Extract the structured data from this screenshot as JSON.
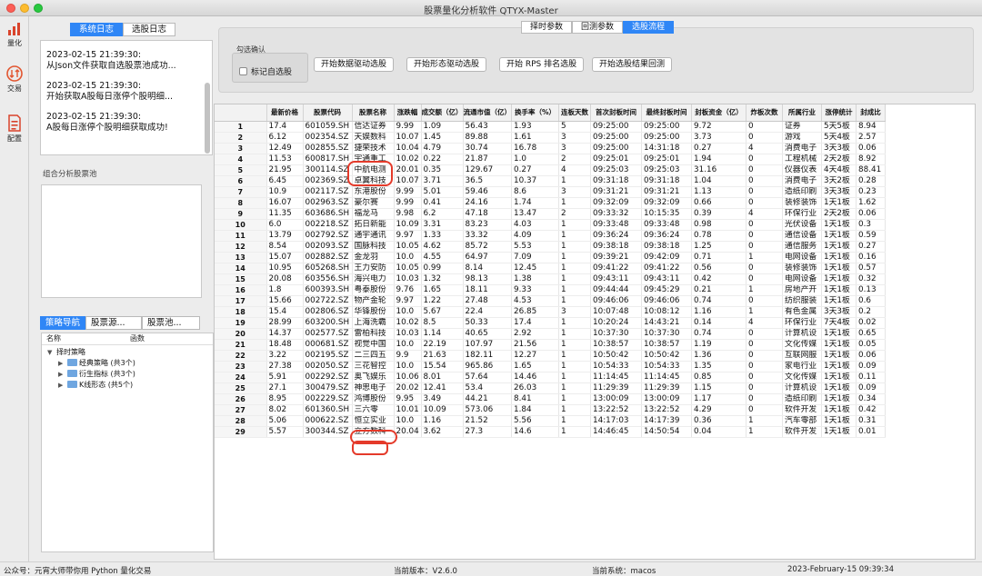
{
  "window": {
    "title": "股票量化分析软件 QTYX-Master"
  },
  "sidebar": {
    "items": [
      {
        "label": "量化",
        "icon": "bar-chart-icon",
        "color": "#d9432b"
      },
      {
        "label": "交易",
        "icon": "exchange-icon",
        "color": "#e2552f"
      },
      {
        "label": "配置",
        "icon": "document-icon",
        "color": "#d9432b"
      }
    ]
  },
  "left": {
    "log_tabs": [
      "系统日志",
      "选股日志"
    ],
    "logs": [
      {
        "time": "2023-02-15 21:39:30:",
        "msg": "从Json文件获取自选股票池成功..."
      },
      {
        "time": "2023-02-15 21:39:30:",
        "msg": "开始获取A股每日涨停个股明细..."
      },
      {
        "time": "2023-02-15 21:39:30:",
        "msg": "A股每日涨停个股明细获取成功!"
      }
    ],
    "pool_label": "组合分析股票池",
    "nav_tabs": [
      "策略导航",
      "股票源...",
      "股票池..."
    ],
    "tree_columns": [
      "名称",
      "函数"
    ],
    "tree": {
      "root": "择时策略",
      "children": [
        "经典策略 (共3个)",
        "衍生指标 (共3个)",
        "K线形态 (共5个)"
      ]
    }
  },
  "main": {
    "top_tabs": [
      "择时参数",
      "回测参数",
      "选股流程"
    ],
    "group_title": "勾选确认",
    "checkbox_label": "标记自选股",
    "buttons": [
      "开始数据驱动选股",
      "开始形态驱动选股",
      "开始 RPS 排名选股",
      "开始选股结果回测"
    ]
  },
  "table": {
    "columns": [
      "",
      "最新价格",
      "股票代码",
      "股票名称",
      "涨跌幅",
      "成交额（亿）",
      "流通市值（亿）",
      "换手率（%）",
      "连板天数",
      "首次封板时间",
      "最终封板时间",
      "封板资金（亿）",
      "炸板次数",
      "所属行业",
      "涨停统计",
      "封成比"
    ],
    "rows": [
      [
        "1",
        "17.4",
        "601059.SH",
        "信达证券",
        "9.99",
        "1.09",
        "56.43",
        "1.93",
        "5",
        "09:25:00",
        "09:25:00",
        "9.72",
        "0",
        "证券",
        "5天5板",
        "8.94"
      ],
      [
        "2",
        "6.12",
        "002354.SZ",
        "天娱数科",
        "10.07",
        "1.45",
        "89.88",
        "1.61",
        "3",
        "09:25:00",
        "09:25:00",
        "3.73",
        "0",
        "游戏",
        "5天4板",
        "2.57"
      ],
      [
        "3",
        "12.49",
        "002855.SZ",
        "捷荣技术",
        "10.04",
        "4.79",
        "30.74",
        "16.78",
        "3",
        "09:25:00",
        "14:31:18",
        "0.27",
        "4",
        "消费电子",
        "3天3板",
        "0.06"
      ],
      [
        "4",
        "11.53",
        "600817.SH",
        "宇通重工",
        "10.02",
        "0.22",
        "21.87",
        "1.0",
        "2",
        "09:25:01",
        "09:25:01",
        "1.94",
        "0",
        "工程机械",
        "2天2板",
        "8.92"
      ],
      [
        "5",
        "21.95",
        "300114.SZ",
        "中航电测",
        "20.01",
        "0.35",
        "129.67",
        "0.27",
        "4",
        "09:25:03",
        "09:25:03",
        "31.16",
        "0",
        "仪器仪表",
        "4天4板",
        "88.41"
      ],
      [
        "6",
        "6.45",
        "002369.SZ",
        "卓翼科技",
        "10.07",
        "3.71",
        "36.5",
        "10.37",
        "1",
        "09:31:18",
        "09:31:18",
        "1.04",
        "0",
        "消费电子",
        "3天2板",
        "0.28"
      ],
      [
        "7",
        "10.9",
        "002117.SZ",
        "东港股份",
        "9.99",
        "5.01",
        "59.46",
        "8.6",
        "3",
        "09:31:21",
        "09:31:21",
        "1.13",
        "0",
        "造纸印刷",
        "3天3板",
        "0.23"
      ],
      [
        "8",
        "16.07",
        "002963.SZ",
        "豪尔赛",
        "9.99",
        "0.41",
        "24.16",
        "1.74",
        "1",
        "09:32:09",
        "09:32:09",
        "0.66",
        "0",
        "装修装饰",
        "1天1板",
        "1.62"
      ],
      [
        "9",
        "11.35",
        "603686.SH",
        "福龙马",
        "9.98",
        "6.2",
        "47.18",
        "13.47",
        "2",
        "09:33:32",
        "10:15:35",
        "0.39",
        "4",
        "环保行业",
        "2天2板",
        "0.06"
      ],
      [
        "10",
        "6.0",
        "002218.SZ",
        "拓日新能",
        "10.09",
        "3.31",
        "83.23",
        "4.03",
        "1",
        "09:33:48",
        "09:33:48",
        "0.98",
        "0",
        "光伏设备",
        "1天1板",
        "0.3"
      ],
      [
        "11",
        "13.79",
        "002792.SZ",
        "通宇通讯",
        "9.97",
        "1.33",
        "33.32",
        "4.09",
        "1",
        "09:36:24",
        "09:36:24",
        "0.78",
        "0",
        "通信设备",
        "1天1板",
        "0.59"
      ],
      [
        "12",
        "8.54",
        "002093.SZ",
        "国脉科技",
        "10.05",
        "4.62",
        "85.72",
        "5.53",
        "1",
        "09:38:18",
        "09:38:18",
        "1.25",
        "0",
        "通信服务",
        "1天1板",
        "0.27"
      ],
      [
        "13",
        "15.07",
        "002882.SZ",
        "金龙羽",
        "10.0",
        "4.55",
        "64.97",
        "7.09",
        "1",
        "09:39:21",
        "09:42:09",
        "0.71",
        "1",
        "电网设备",
        "1天1板",
        "0.16"
      ],
      [
        "14",
        "10.95",
        "605268.SH",
        "王力安防",
        "10.05",
        "0.99",
        "8.14",
        "12.45",
        "1",
        "09:41:22",
        "09:41:22",
        "0.56",
        "0",
        "装修装饰",
        "1天1板",
        "0.57"
      ],
      [
        "15",
        "20.08",
        "603556.SH",
        "海兴电力",
        "10.03",
        "1.32",
        "98.13",
        "1.38",
        "1",
        "09:43:11",
        "09:43:11",
        "0.42",
        "0",
        "电网设备",
        "1天1板",
        "0.32"
      ],
      [
        "16",
        "1.8",
        "600393.SH",
        "粤泰股份",
        "9.76",
        "1.65",
        "18.11",
        "9.33",
        "1",
        "09:44:44",
        "09:45:29",
        "0.21",
        "1",
        "房地产开",
        "1天1板",
        "0.13"
      ],
      [
        "17",
        "15.66",
        "002722.SZ",
        "物产金轮",
        "9.97",
        "1.22",
        "27.48",
        "4.53",
        "1",
        "09:46:06",
        "09:46:06",
        "0.74",
        "0",
        "纺织服装",
        "1天1板",
        "0.6"
      ],
      [
        "18",
        "15.4",
        "002806.SZ",
        "华锋股份",
        "10.0",
        "5.67",
        "22.4",
        "26.85",
        "3",
        "10:07:48",
        "10:08:12",
        "1.16",
        "1",
        "有色金属",
        "3天3板",
        "0.2"
      ],
      [
        "19",
        "28.99",
        "603200.SH",
        "上海洗霸",
        "10.02",
        "8.5",
        "50.33",
        "17.4",
        "1",
        "10:20:24",
        "14:43:21",
        "0.14",
        "4",
        "环保行业",
        "7天4板",
        "0.02"
      ],
      [
        "20",
        "14.37",
        "002577.SZ",
        "雷柏科技",
        "10.03",
        "1.14",
        "40.65",
        "2.92",
        "1",
        "10:37:30",
        "10:37:30",
        "0.74",
        "0",
        "计算机设",
        "1天1板",
        "0.65"
      ],
      [
        "21",
        "18.48",
        "000681.SZ",
        "视觉中国",
        "10.0",
        "22.19",
        "107.97",
        "21.56",
        "1",
        "10:38:57",
        "10:38:57",
        "1.19",
        "0",
        "文化传媒",
        "1天1板",
        "0.05"
      ],
      [
        "22",
        "3.22",
        "002195.SZ",
        "二三四五",
        "9.9",
        "21.63",
        "182.11",
        "12.27",
        "1",
        "10:50:42",
        "10:50:42",
        "1.36",
        "0",
        "互联网服",
        "1天1板",
        "0.06"
      ],
      [
        "23",
        "27.38",
        "002050.SZ",
        "三花智控",
        "10.0",
        "15.54",
        "965.86",
        "1.65",
        "1",
        "10:54:33",
        "10:54:33",
        "1.35",
        "0",
        "家电行业",
        "1天1板",
        "0.09"
      ],
      [
        "24",
        "5.91",
        "002292.SZ",
        "奥飞娱乐",
        "10.06",
        "8.01",
        "57.64",
        "14.46",
        "1",
        "11:14:45",
        "11:14:45",
        "0.85",
        "0",
        "文化传媒",
        "1天1板",
        "0.11"
      ],
      [
        "25",
        "27.1",
        "300479.SZ",
        "神思电子",
        "20.02",
        "12.41",
        "53.4",
        "26.03",
        "1",
        "11:29:39",
        "11:29:39",
        "1.15",
        "0",
        "计算机设",
        "1天1板",
        "0.09"
      ],
      [
        "26",
        "8.95",
        "002229.SZ",
        "鸿博股份",
        "9.95",
        "3.49",
        "44.21",
        "8.41",
        "1",
        "13:00:09",
        "13:00:09",
        "1.17",
        "0",
        "造纸印刷",
        "1天1板",
        "0.34"
      ],
      [
        "27",
        "8.02",
        "601360.SH",
        "三六零",
        "10.01",
        "10.09",
        "573.06",
        "1.84",
        "1",
        "13:22:52",
        "13:22:52",
        "4.29",
        "0",
        "软件开发",
        "1天1板",
        "0.42"
      ],
      [
        "28",
        "5.06",
        "000622.SZ",
        "恒立实业",
        "10.0",
        "1.16",
        "21.52",
        "5.56",
        "1",
        "14:17:03",
        "14:17:39",
        "0.36",
        "1",
        "汽车零部",
        "1天1板",
        "0.31"
      ],
      [
        "29",
        "5.57",
        "300344.SZ",
        "立方数科",
        "20.04",
        "3.62",
        "27.3",
        "14.6",
        "1",
        "14:46:45",
        "14:50:54",
        "0.04",
        "1",
        "软件开发",
        "1天1板",
        "0.01"
      ]
    ],
    "highlight_color": "#e43a2a"
  },
  "status": {
    "wechat": "公众号：元宵大师带你用 Python 量化交易",
    "version": "当前版本：V2.6.0",
    "system": "当前系统：macos",
    "time": "2023-February-15 09:39:34"
  }
}
